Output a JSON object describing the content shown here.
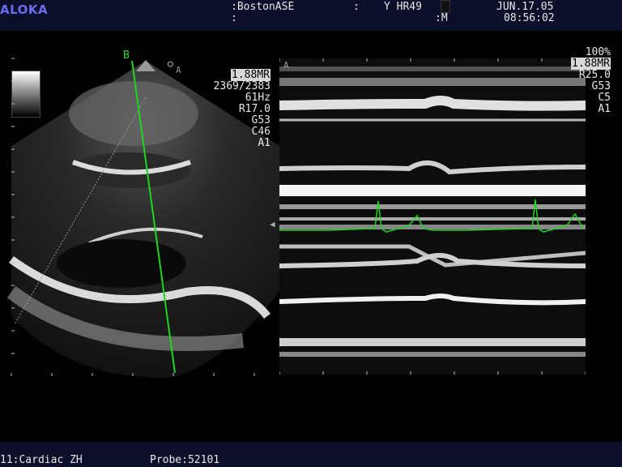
{
  "header": {
    "brand": "ALOKA",
    "site_line1": ":BostonASE",
    "site_line2": ":",
    "sep": ":",
    "hr_label": "Y HR49",
    "mode": ":M",
    "date": "JUN.17.05",
    "time": "08:56:02"
  },
  "left_params": {
    "depth": "1.88MR",
    "frame": "2369/2383",
    "freq": "61Hz",
    "range": "R17.0",
    "gain": "G53",
    "contrast": "C46",
    "a": "A1"
  },
  "right_params": {
    "pct": "100%",
    "depth": "1.88MR",
    "range": "R25.0",
    "gain": "G53",
    "contrast": "C5",
    "a": "A1"
  },
  "markers": {
    "b_line": "B",
    "a_left": "A",
    "a_right": "A"
  },
  "footer": {
    "preset": "11:Cardiac ZH",
    "probe": "Probe:52101"
  },
  "colors": {
    "brand": "#6c6cf0",
    "ecg": "#1fd51f",
    "header_bg": "#0b0f2a"
  }
}
